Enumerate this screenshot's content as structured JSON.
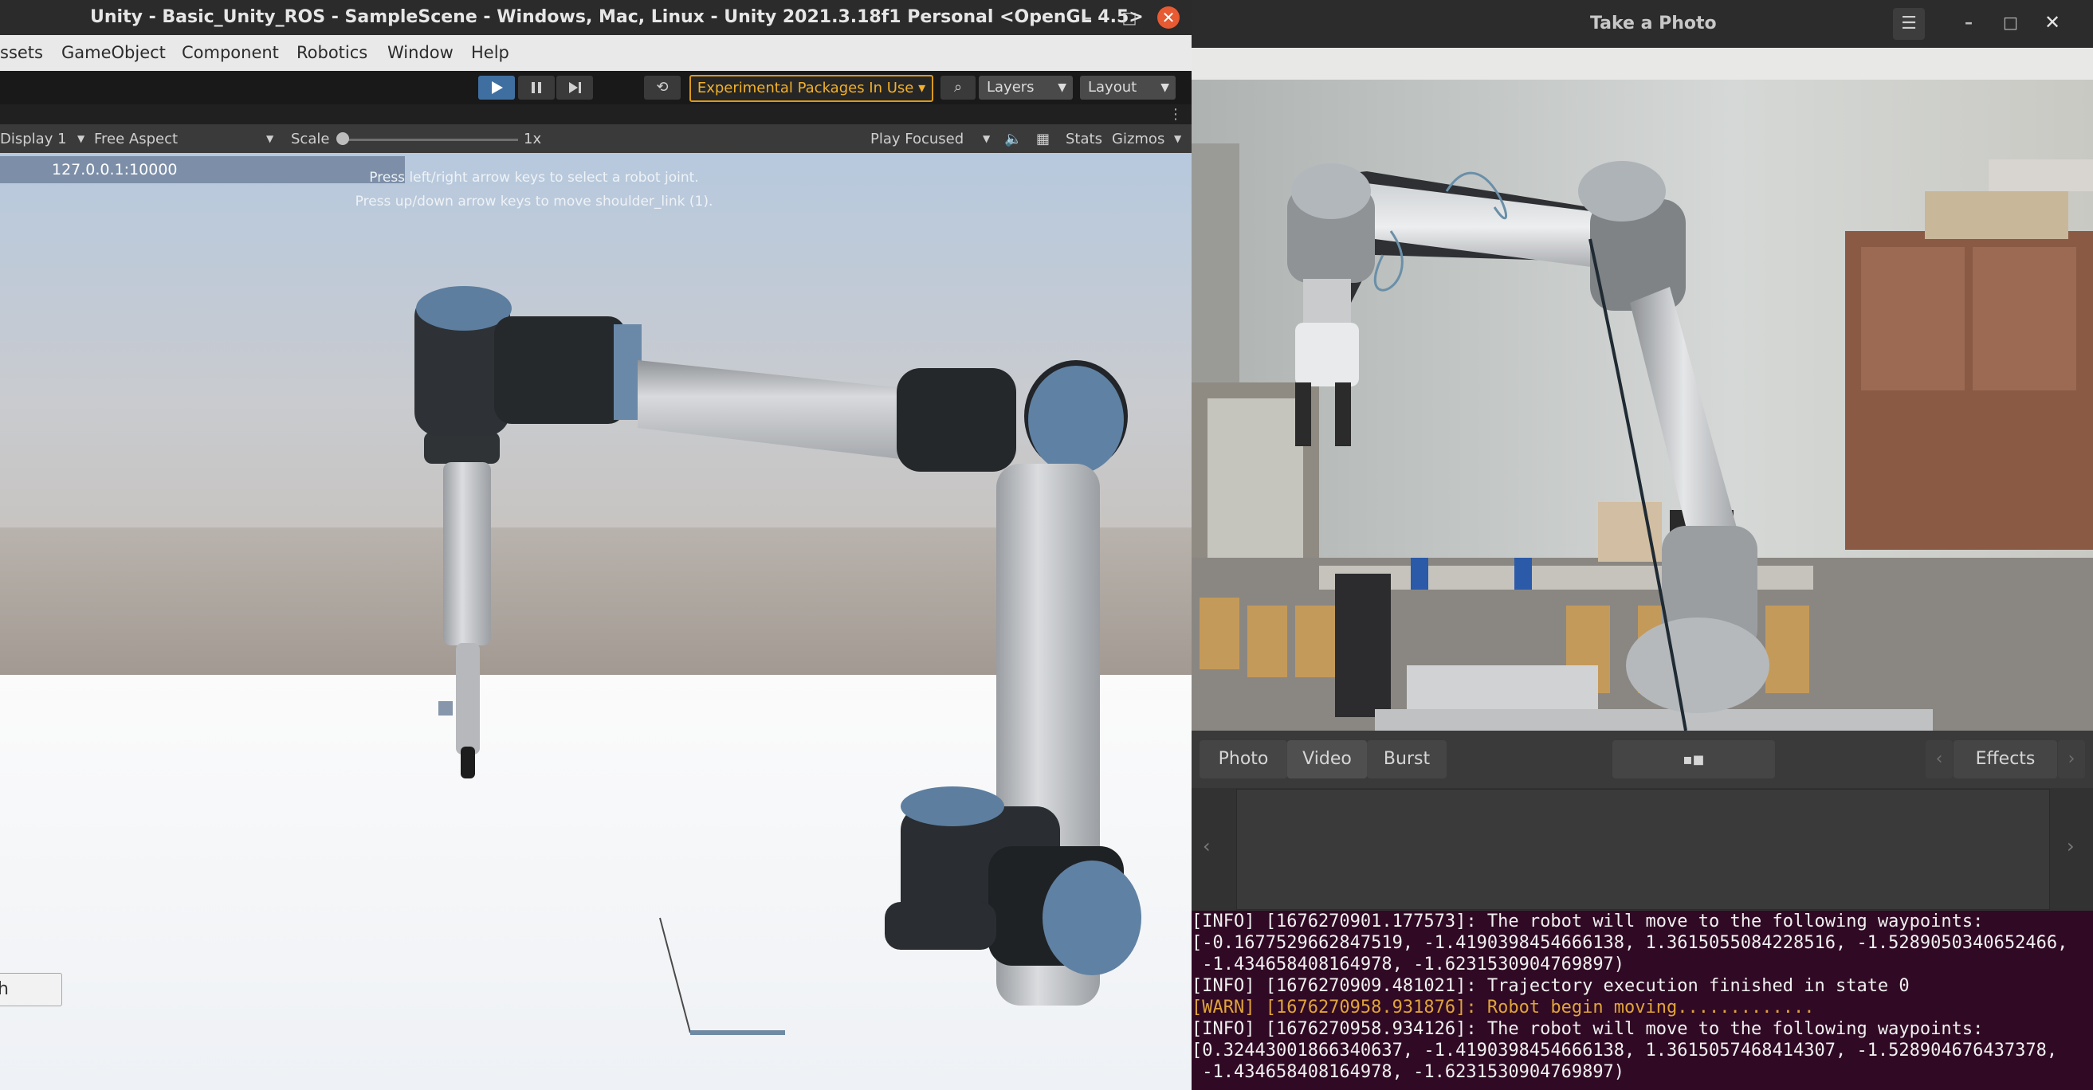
{
  "unity": {
    "title": "Unity - Basic_Unity_ROS - SampleScene - Windows, Mac, Linux - Unity 2021.3.18f1 Personal <OpenGL 4.5>",
    "menu": [
      "ssets",
      "GameObject",
      "Component",
      "Robotics",
      "Window",
      "Help"
    ],
    "toolbar": {
      "experimental_label": "Experimental Packages In Use ▾",
      "layers_label": "Layers",
      "layout_label": "Layout"
    },
    "gamebar": {
      "display": "Display 1",
      "aspect": "Free Aspect",
      "scale_label": "Scale",
      "scale_value": "1x",
      "play_mode": "Play Focused",
      "stats": "Stats",
      "gizmos": "Gizmos"
    },
    "game": {
      "ip": "127.0.0.1:10000",
      "hint_line1": "Press left/right arrow keys to select a robot joint.",
      "hint_line2": "Press up/down arrow keys to move shoulder_link (1).",
      "text_box": "h"
    }
  },
  "camera": {
    "title": "Take a Photo",
    "modes": [
      "Photo",
      "Video",
      "Burst"
    ],
    "effects_label": "Effects"
  },
  "terminal": {
    "lines": [
      {
        "text": "[INFO] [1676270901.177573]: The robot will move to the following waypoints:",
        "level": "info"
      },
      {
        "text": "[-0.1677529662847519, -1.4190398454666138, 1.3615055084228516, -1.5289050340652466,",
        "level": "info"
      },
      {
        "text": " -1.434658408164978, -1.6231530904769897)",
        "level": "info"
      },
      {
        "text": "[INFO] [1676270909.481021]: Trajectory execution finished in state 0",
        "level": "info"
      },
      {
        "text": "[WARN] [1676270958.931876]: Robot begin moving.............",
        "level": "warn"
      },
      {
        "text": "[INFO] [1676270958.934126]: The robot will move to the following waypoints:",
        "level": "info"
      },
      {
        "text": "[0.32443001866340637, -1.4190398454666138, 1.3615057468414307, -1.528904676437378,",
        "level": "info"
      },
      {
        "text": " -1.434658408164978, -1.6231530904769897)",
        "level": "info"
      }
    ]
  }
}
